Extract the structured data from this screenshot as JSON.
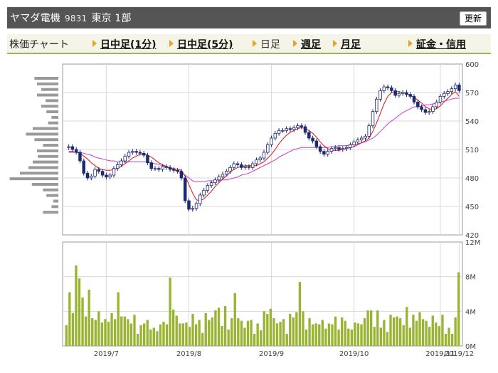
{
  "header": {
    "name": "ヤマダ電機",
    "code": "9831",
    "market": "東京 1部",
    "refresh_label": "更新"
  },
  "nav": {
    "label": "株価チャート",
    "items": [
      {
        "label": "日中足(1分)",
        "link": true
      },
      {
        "label": "日中足(5分)",
        "link": true
      },
      {
        "label": "日足",
        "link": false
      },
      {
        "label": "週足",
        "link": true
      },
      {
        "label": "月足",
        "link": true
      },
      {
        "label": "証金・信用",
        "link": true
      }
    ]
  },
  "colors": {
    "up": "#ffffff",
    "down": "#1a2b6e",
    "ma": "#cc33cc",
    "volume": "#99b433",
    "header_bg": "#555555",
    "accent": "#f0a020"
  },
  "chart_data": [
    {
      "type": "candlestick",
      "x_labels": [
        "2019/7",
        "2019/8",
        "2019/9",
        "2019/10",
        "2019/11",
        "2019/12"
      ],
      "ylim": [
        420,
        600
      ],
      "yticks": [
        420,
        450,
        480,
        510,
        540,
        570,
        600
      ],
      "closes": [
        513,
        510,
        507,
        498,
        485,
        480,
        482,
        489,
        487,
        483,
        481,
        483,
        490,
        494,
        498,
        503,
        507,
        508,
        507,
        506,
        504,
        496,
        490,
        490,
        489,
        492,
        491,
        489,
        488,
        487,
        480,
        456,
        447,
        448,
        453,
        462,
        467,
        472,
        475,
        478,
        481,
        484,
        487,
        491,
        495,
        494,
        491,
        492,
        491,
        495,
        499,
        501,
        507,
        515,
        522,
        527,
        530,
        530,
        532,
        531,
        533,
        535,
        534,
        528,
        522,
        519,
        513,
        508,
        505,
        508,
        511,
        512,
        510,
        511,
        512,
        515,
        518,
        520,
        522,
        524,
        535,
        550,
        563,
        572,
        576,
        575,
        572,
        567,
        569,
        570,
        568,
        566,
        560,
        555,
        552,
        549,
        550,
        555,
        560,
        566,
        569,
        571,
        574,
        578,
        572
      ],
      "opens": [
        512,
        513,
        510,
        507,
        498,
        485,
        480,
        482,
        489,
        487,
        483,
        481,
        483,
        490,
        494,
        498,
        503,
        507,
        508,
        507,
        506,
        504,
        496,
        490,
        490,
        489,
        492,
        491,
        489,
        488,
        487,
        480,
        456,
        447,
        448,
        453,
        462,
        467,
        472,
        475,
        478,
        481,
        484,
        487,
        491,
        495,
        494,
        491,
        492,
        491,
        495,
        499,
        501,
        507,
        515,
        522,
        527,
        530,
        530,
        532,
        531,
        533,
        535,
        534,
        528,
        522,
        519,
        513,
        508,
        505,
        508,
        511,
        512,
        510,
        511,
        512,
        515,
        518,
        520,
        522,
        524,
        535,
        550,
        563,
        572,
        576,
        575,
        572,
        567,
        569,
        570,
        568,
        566,
        560,
        555,
        552,
        549,
        550,
        555,
        560,
        566,
        569,
        571,
        574,
        578
      ],
      "ma_short": [
        508,
        508,
        507,
        506,
        503,
        500,
        496,
        493,
        490,
        489,
        488,
        488,
        489,
        490,
        492,
        495,
        498,
        501,
        503,
        505,
        505,
        504,
        502,
        499,
        496,
        494,
        492,
        490,
        490,
        489,
        488,
        482,
        473,
        464,
        457,
        456,
        458,
        462,
        466,
        471,
        475,
        479,
        482,
        486,
        489,
        491,
        492,
        493,
        493,
        493,
        493,
        495,
        497,
        501,
        505,
        510,
        516,
        521,
        525,
        528,
        530,
        532,
        533,
        532,
        530,
        527,
        523,
        518,
        514,
        511,
        509,
        509,
        509,
        510,
        511,
        512,
        513,
        515,
        517,
        519,
        522,
        529,
        538,
        548,
        558,
        566,
        570,
        571,
        571,
        570,
        569,
        567,
        565,
        562,
        559,
        555,
        553,
        552,
        553,
        556,
        560,
        564,
        568,
        571,
        566
      ],
      "ma_long": [
        507,
        507,
        507,
        507,
        506,
        505,
        504,
        502,
        501,
        500,
        499,
        498,
        498,
        497,
        497,
        497,
        497,
        497,
        497,
        497,
        497,
        497,
        496,
        495,
        494,
        493,
        492,
        491,
        489,
        487,
        485,
        483,
        480,
        477,
        476,
        476,
        476,
        477,
        477,
        477,
        477,
        478,
        478,
        479,
        480,
        481,
        483,
        484,
        485,
        487,
        489,
        491,
        493,
        495,
        497,
        499,
        502,
        504,
        506,
        508,
        510,
        511,
        512,
        512,
        512,
        512,
        512,
        512,
        512,
        512,
        513,
        513,
        514,
        514,
        514,
        515,
        515,
        516,
        517,
        518,
        520,
        522,
        525,
        529,
        533,
        537,
        540,
        543,
        546,
        549,
        551,
        553,
        555,
        555,
        556,
        557,
        557,
        558,
        559,
        560,
        561,
        562,
        563,
        564,
        564
      ],
      "volume": [
        2.4,
        6.2,
        3.8,
        9.3,
        7.8,
        5.6,
        3.4,
        6.5,
        3.2,
        3.0,
        4.0,
        2.7,
        3.1,
        2.8,
        3.8,
        3.1,
        6.2,
        3.4,
        3.4,
        3.1,
        2.6,
        3.6,
        1.4,
        2.4,
        2.6,
        3.0,
        1.9,
        2.1,
        1.7,
        2.5,
        2.8,
        2.5,
        7.9,
        4.2,
        3.5,
        2.6,
        2.6,
        2.7,
        2.2,
        3.7,
        2.5,
        3.0,
        1.5,
        3.8,
        3.0,
        3.3,
        4.1,
        4.4,
        2.3,
        4.6,
        1.9,
        3.2,
        6.1,
        3.2,
        2.9,
        2.1,
        2.9,
        3.0,
        1.4,
        2.6,
        1.8,
        4.0,
        3.7,
        4.3,
        3.2,
        2.6,
        2.8,
        3.1,
        1.4,
        3.7,
        3.3,
        3.9,
        7.4,
        4.0,
        1.9,
        3.2,
        2.5,
        2.6,
        2.5,
        3.0,
        2.0,
        2.6,
        2.5,
        3.4,
        1.9,
        3.3,
        2.9,
        2.0,
        1.9,
        2.7,
        2.6,
        2.5,
        3.2,
        4.1,
        4.1,
        2.2,
        4.1,
        2.1,
        3.0,
        1.6,
        3.6,
        3.3,
        3.4,
        3.2,
        2.4,
        4.5,
        2.1,
        3.6,
        2.9,
        3.9,
        3.1,
        2.9,
        2.2,
        3.5,
        2.7,
        2.3,
        3.6,
        1.4,
        2.1,
        1.4,
        3.3,
        8.5
      ],
      "volume_ylim": [
        0,
        12
      ],
      "volume_yticks": [
        "0M",
        "4M",
        "8M",
        "12M"
      ],
      "price_volume_profile": [
        0.28,
        0.25,
        0.2,
        0.25,
        0.15,
        0.2,
        0.14,
        0.08,
        0.12,
        0.3,
        0.38,
        0.28,
        0.18,
        0.25,
        0.24,
        0.3,
        0.35,
        0.45,
        0.57,
        0.31,
        0.18,
        0.14,
        0.06,
        0.08,
        0.18
      ]
    }
  ]
}
